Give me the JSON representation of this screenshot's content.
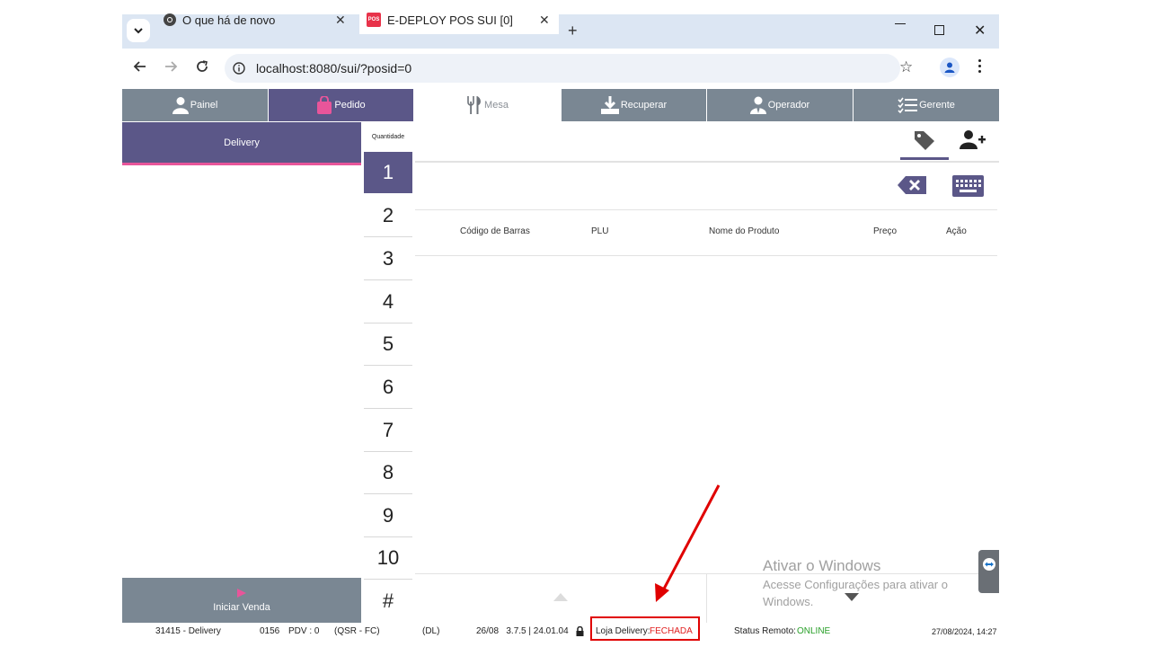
{
  "browser": {
    "tabs": [
      {
        "title": "O que há de novo",
        "icon": "chrome-icon"
      },
      {
        "title": "E-DEPLOY POS SUI [0]",
        "icon_text": "POS"
      }
    ],
    "url": "localhost:8080/sui/?posid=0"
  },
  "nav": {
    "items": [
      {
        "label": "Painel"
      },
      {
        "label": "Pedido"
      },
      {
        "label": "Mesa"
      },
      {
        "label": "Recuperar"
      },
      {
        "label": "Operador"
      },
      {
        "label": "Gerente"
      }
    ]
  },
  "left_panel": {
    "tab_label": "Delivery",
    "start_label": "Iniciar Venda"
  },
  "numpad": {
    "header": "Quantidade",
    "keys": [
      "1",
      "2",
      "3",
      "4",
      "5",
      "6",
      "7",
      "8",
      "9",
      "10",
      "#"
    ],
    "selected": "1"
  },
  "table": {
    "columns": [
      "Código de Barras",
      "PLU",
      "Nome do Produto",
      "Preço",
      "Ação"
    ]
  },
  "watermark": {
    "title": "Ativar o Windows",
    "line1": "Acesse Configurações para ativar o",
    "line2": "Windows."
  },
  "status": {
    "store": "31415 - Delivery",
    "code": "0156",
    "pdv": "PDV : 0",
    "mode": "(QSR - FC)",
    "dl": "(DL)",
    "date_version": "26/08   3.7.5 | 24.01.04",
    "delivery_label": "Loja Delivery:",
    "delivery_value": "FECHADA",
    "remote_label": "Status Remoto:",
    "remote_value": "ONLINE",
    "datetime": "27/08/2024, 14:27"
  },
  "colors": {
    "nav_gray": "#7a8793",
    "nav_purple": "#5b5788",
    "accent_pink": "#e8559a",
    "closed_red": "#e02020",
    "online_green": "#2aa02a",
    "annotation_red": "#e00000"
  }
}
